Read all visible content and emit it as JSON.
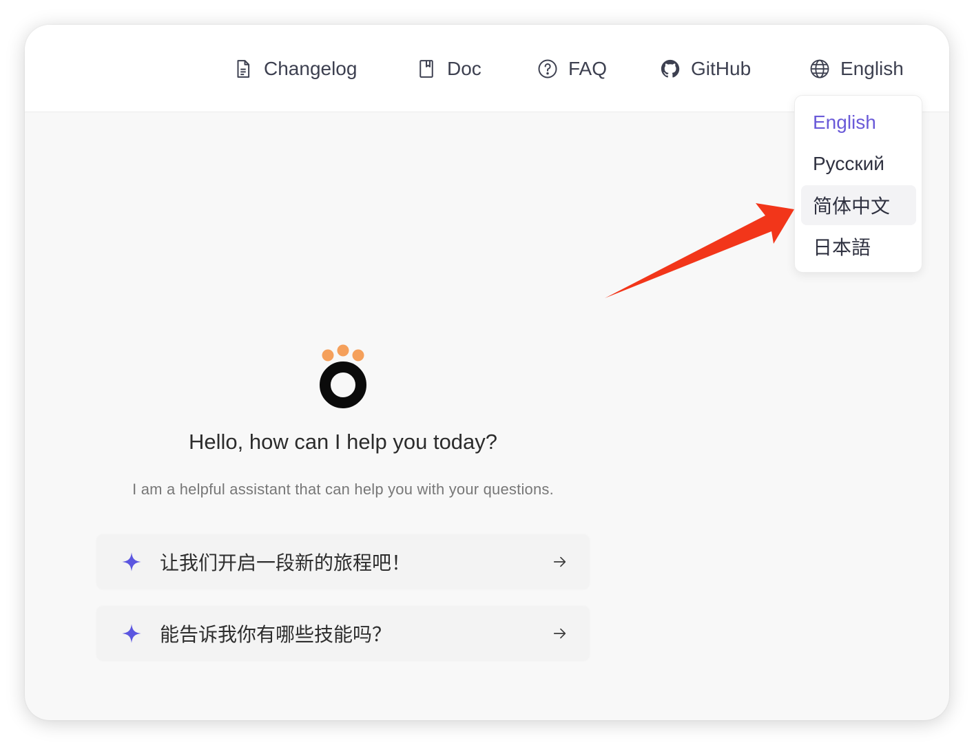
{
  "nav": {
    "items": [
      {
        "label": "Changelog",
        "icon": "document-icon"
      },
      {
        "label": "Doc",
        "icon": "book-icon"
      },
      {
        "label": "FAQ",
        "icon": "question-circle-icon"
      },
      {
        "label": "GitHub",
        "icon": "github-icon"
      },
      {
        "label": "English",
        "icon": "globe-icon"
      }
    ]
  },
  "language_menu": {
    "options": [
      "English",
      "Русский",
      "简体中文",
      "日本語"
    ],
    "selected": "English",
    "hovered": "简体中文"
  },
  "colors": {
    "accent": "#6a5ad8",
    "annotation_arrow": "#f2361a",
    "logo_dots": "#f5a05b"
  },
  "welcome": {
    "title": "Hello, how can I help you today?",
    "subtitle": "I am a helpful assistant that can help you with your questions."
  },
  "suggestions": [
    {
      "text": "让我们开启一段新的旅程吧！",
      "icon": "sparkle-icon"
    },
    {
      "text": "能告诉我你有哪些技能吗？",
      "icon": "sparkle-icon"
    }
  ]
}
